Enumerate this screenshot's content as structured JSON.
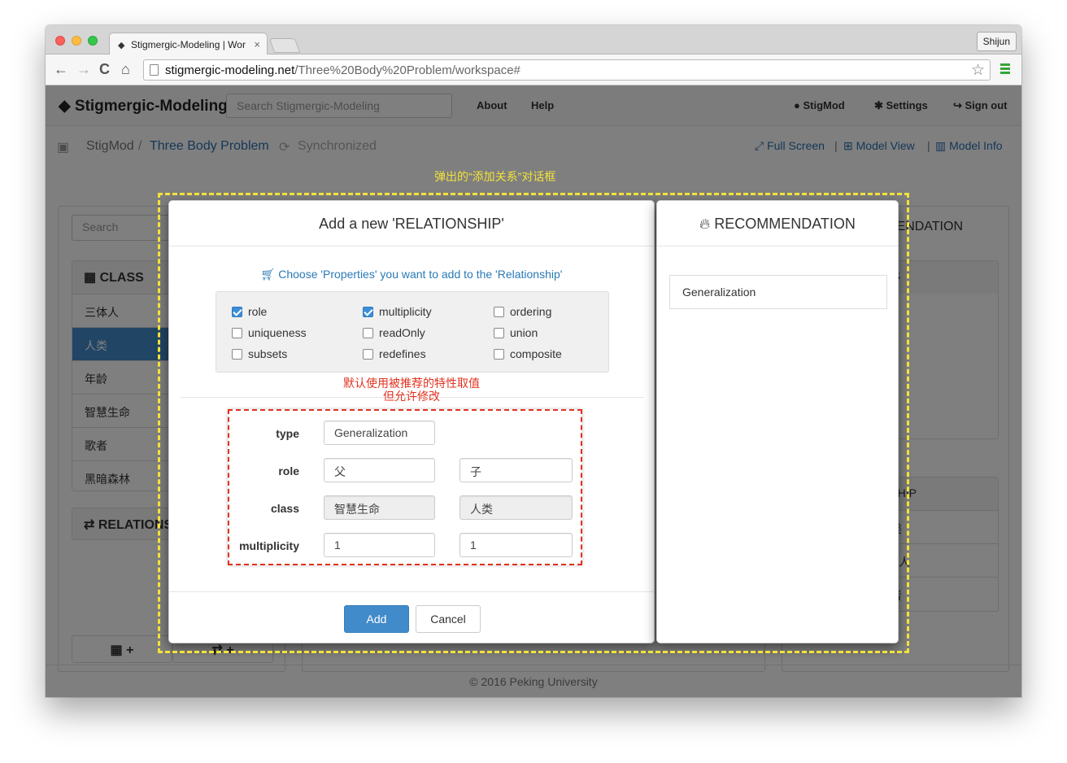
{
  "browser": {
    "tab_title": "Stigmergic-Modeling | Wor",
    "tab_close": "×",
    "user_button": "Shijun",
    "back": "←",
    "forward": "→",
    "reload": "C",
    "home": "⌂",
    "url_host": "stigmergic-modeling.net",
    "url_path": "/Three%20Body%20Problem/workspace#",
    "star": "☆"
  },
  "navbar": {
    "brand": "Stigmergic-Modeling",
    "search_placeholder": "Search Stigmergic-Modeling",
    "links": [
      "About",
      "Help"
    ],
    "user": "StigMod",
    "settings": "Settings",
    "signout": "Sign out"
  },
  "breadcrumb": {
    "root": "StigMod",
    "sep": "/",
    "project": "Three Body Problem",
    "status": "Synchronized",
    "full_screen": "Full Screen",
    "model_view": "Model View",
    "model_info": "Model Info",
    "divider": "|"
  },
  "left_panel": {
    "search_placeholder": "Search",
    "class_header": "CLASS",
    "classes": [
      "三体人",
      "人类",
      "年龄",
      "智慧生命",
      "歌者",
      "黑暗森林"
    ],
    "selected_class": "人类",
    "relation_header": "RELATIONS",
    "add_class": "+",
    "add_relation": "+"
  },
  "right_panel": {
    "rec_header_partial": "ENDATION",
    "class_partial": "SS",
    "relationship_partial": "NSHIP",
    "items_partial": [
      "人类",
      "三体人",
      "歌者"
    ]
  },
  "footer": "© 2016 Peking University",
  "modal": {
    "title": "Add a new 'RELATIONSHIP'",
    "hint": "Choose 'Properties' you want to add to the 'Relationship'",
    "properties": [
      {
        "label": "role",
        "checked": true
      },
      {
        "label": "multiplicity",
        "checked": true
      },
      {
        "label": "ordering",
        "checked": false
      },
      {
        "label": "uniqueness",
        "checked": false
      },
      {
        "label": "readOnly",
        "checked": false
      },
      {
        "label": "union",
        "checked": false
      },
      {
        "label": "subsets",
        "checked": false
      },
      {
        "label": "redefines",
        "checked": false
      },
      {
        "label": "composite",
        "checked": false
      }
    ],
    "fields": {
      "type_label": "type",
      "type_value": "Generalization",
      "role_label": "role",
      "role_left": "父",
      "role_right": "子",
      "class_label": "class",
      "class_left": "智慧生命",
      "class_right": "人类",
      "multiplicity_label": "multiplicity",
      "multiplicity_left": "1",
      "multiplicity_right": "1"
    },
    "add_button": "Add",
    "cancel_button": "Cancel"
  },
  "recommendation": {
    "title": "RECOMMENDATION",
    "items": [
      "Generalization"
    ]
  },
  "annotations": {
    "dialog_note": "弹出的“添加关系”对话框",
    "default_note_line1": "默认使用被推荐的特性取值",
    "default_note_line2": "但允许修改"
  },
  "colors": {
    "primary": "#428bca",
    "link": "#2a6fb0",
    "annotation_yellow": "#f2e23a",
    "annotation_red": "#e3311f"
  }
}
